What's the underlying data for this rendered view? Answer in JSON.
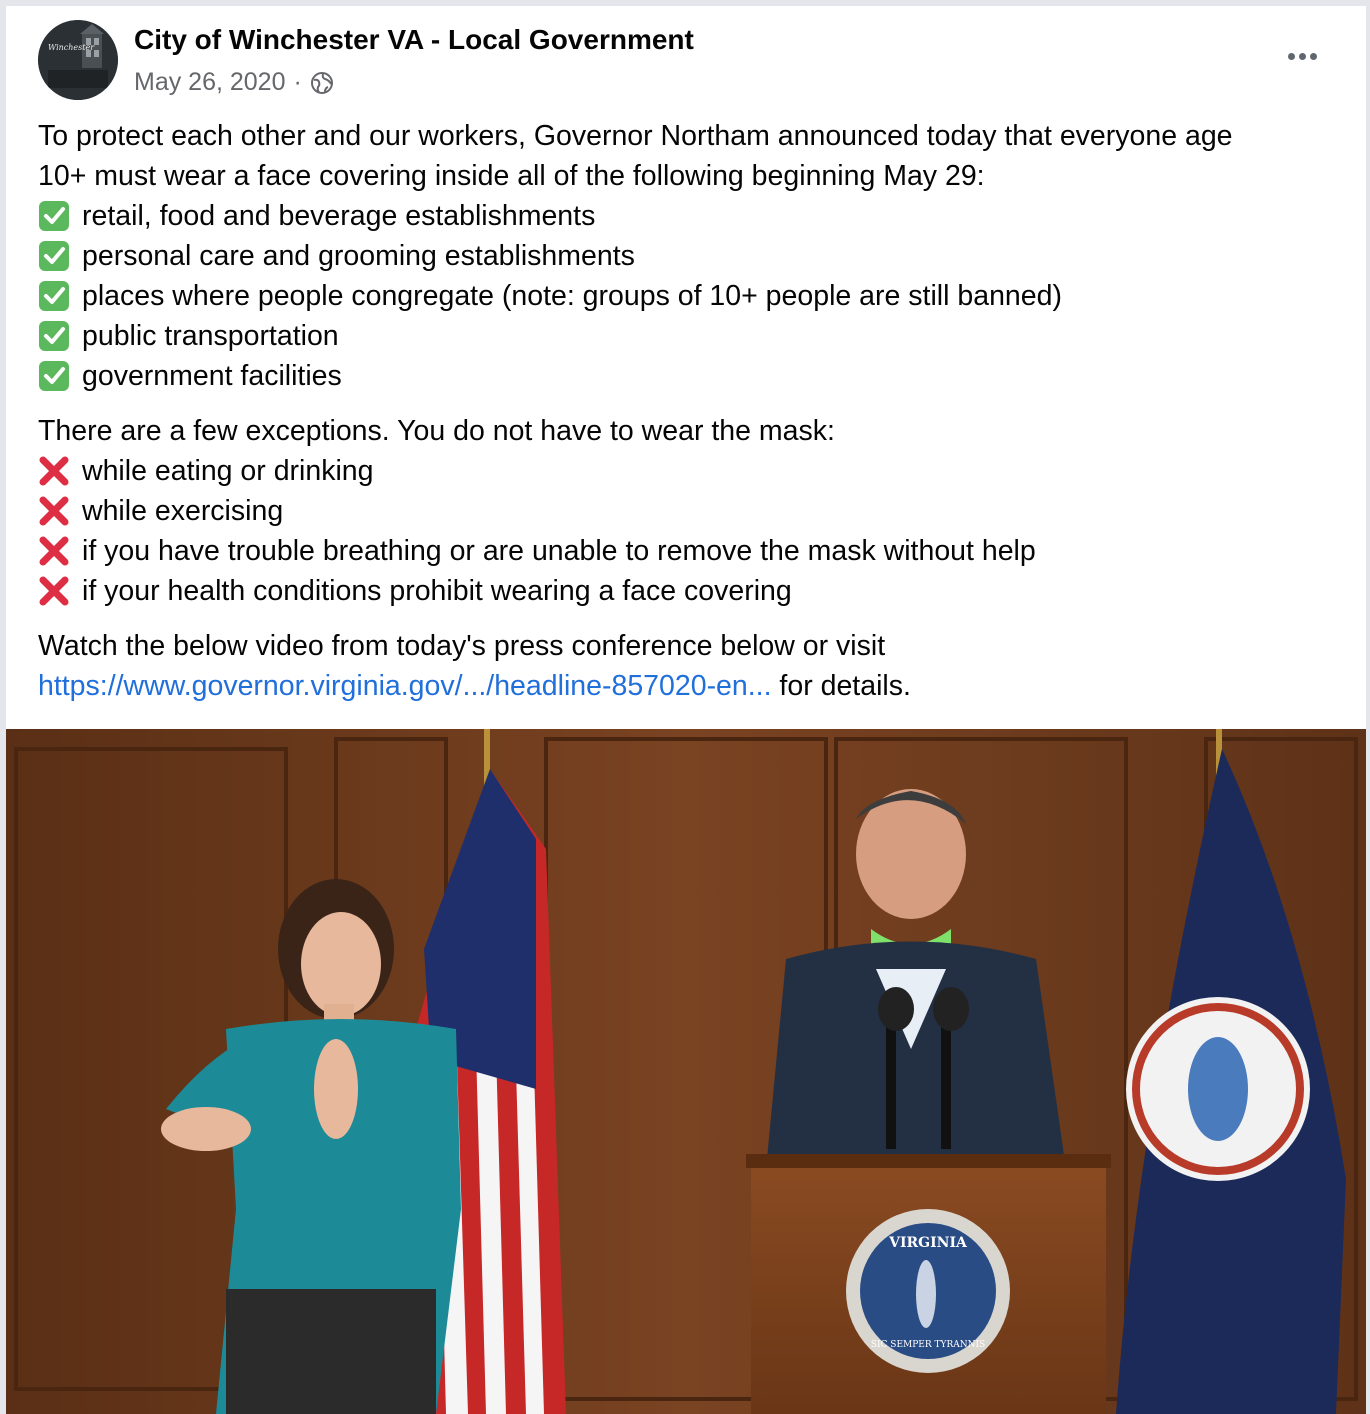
{
  "post": {
    "page_name": "City of Winchester VA - Local Government",
    "date": "May 26, 2020",
    "separator": "·",
    "privacy_icon": "globe-icon",
    "more_icon": "more-horizontal-icon",
    "avatar_text": "Winchester",
    "intro": [
      "To protect each other and our workers, Governor Northam announced today that everyone age",
      "10+ must wear a face covering inside all of the following beginning May 29:"
    ],
    "required_items": [
      "retail, food and beverage establishments",
      "personal care and grooming establishments",
      "places where people congregate (note: groups of 10+ people are still banned)",
      "public transportation",
      "government facilities"
    ],
    "exceptions_intro": "There are a few exceptions. You do not have to wear the mask:",
    "exception_items": [
      "while eating or drinking",
      "while exercising",
      "if you have trouble breathing or are unable to remove the mask without help",
      "if your health conditions prohibit wearing a face covering"
    ],
    "footer_line1": "Watch the below video from today's press conference below or visit",
    "footer_link": "https://www.governor.virginia.gov/.../headline-857020-en...",
    "footer_suffix": " for details.",
    "check_icon": "check-mark-button-icon",
    "cross_icon": "cross-mark-icon",
    "video_seal_text": "VIRGINIA",
    "video_seal_motto": "SIC SEMPER TYRANNIS"
  },
  "colors": {
    "page_name": "#050505",
    "meta": "#65676b",
    "link": "#216fdb",
    "check_green": "#5cb85c",
    "cross_red": "#dd2e44",
    "wood": "#6b3a1c"
  }
}
